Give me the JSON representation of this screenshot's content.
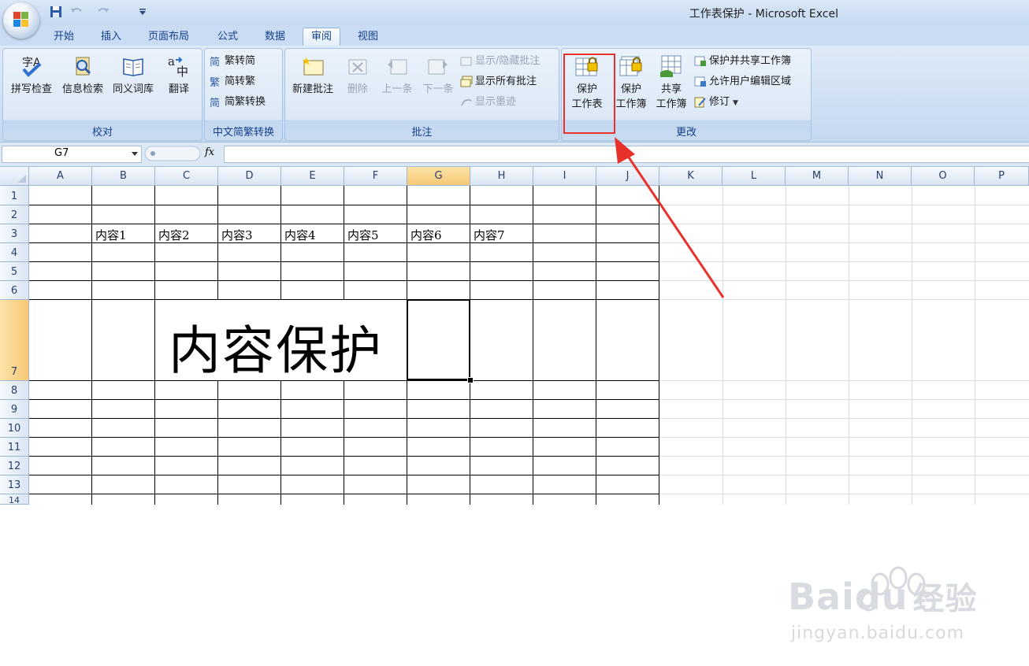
{
  "window": {
    "title": "工作表保护 - Microsoft Excel"
  },
  "tabs": [
    "开始",
    "插入",
    "页面布局",
    "公式",
    "数据",
    "审阅",
    "视图"
  ],
  "active_tab": "审阅",
  "ribbon": {
    "proofing": {
      "label": "校对",
      "spelling": "拼写检查",
      "research": "信息检索",
      "thesaurus": "同义词库",
      "translate": "翻译"
    },
    "chinese": {
      "label": "中文简繁转换",
      "to_simplified": "繁转简",
      "to_traditional": "简转繁",
      "convert": "简繁转换"
    },
    "comments": {
      "label": "批注",
      "new": "新建批注",
      "delete": "删除",
      "previous": "上一条",
      "next": "下一条",
      "show_hide": "显示/隐藏批注",
      "show_all": "显示所有批注",
      "show_ink": "显示墨迹"
    },
    "changes": {
      "label": "更改",
      "protect_sheet_l1": "保护",
      "protect_sheet_l2": "工作表",
      "protect_wb_l1": "保护",
      "protect_wb_l2": "工作簿",
      "share_wb_l1": "共享",
      "share_wb_l2": "工作簿",
      "protect_share": "保护并共享工作簿",
      "allow_edit": "允许用户编辑区域",
      "track": "修订"
    }
  },
  "formula_bar": {
    "name_box": "G7",
    "fx": "fx",
    "value": ""
  },
  "sheet": {
    "columns": [
      "A",
      "B",
      "C",
      "D",
      "E",
      "F",
      "G",
      "H",
      "I",
      "J",
      "K",
      "L",
      "M",
      "N",
      "O",
      "P"
    ],
    "rows": [
      "1",
      "2",
      "3",
      "4",
      "5",
      "6",
      "7",
      "8",
      "9",
      "10",
      "11",
      "12",
      "13",
      "14"
    ],
    "selected_col": "G",
    "selected_row": "7",
    "row3": [
      "内容1",
      "内容2",
      "内容3",
      "内容4",
      "内容5",
      "内容6",
      "内容7"
    ],
    "big_text": "内容保护"
  },
  "watermark": {
    "brand": "Baidu",
    "brand_cn": "经验",
    "url": "jingyan.baidu.com"
  }
}
